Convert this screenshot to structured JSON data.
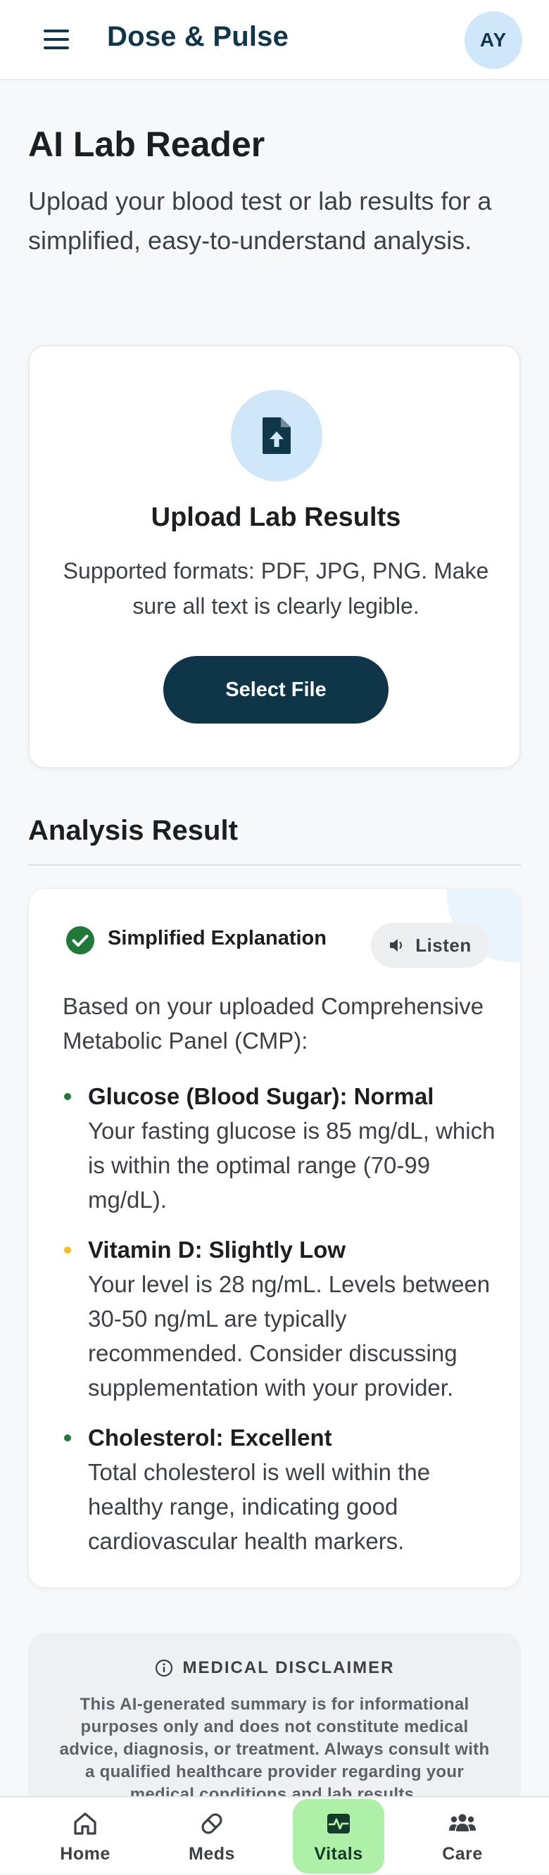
{
  "header": {
    "app_title": "Dose & Pulse",
    "avatar_initials": "AY"
  },
  "page": {
    "title": "AI Lab Reader",
    "subtitle": "Upload your blood test or lab results for a simplified, easy-to-understand analysis."
  },
  "upload": {
    "title": "Upload Lab Results",
    "description": "Supported formats: PDF, JPG, PNG. Make sure all text is clearly legible.",
    "button_label": "Select File"
  },
  "analysis": {
    "heading": "Analysis Result",
    "explain_label": "Simplified Explanation",
    "listen_label": "Listen",
    "intro": "Based on your uploaded Comprehensive Metabolic Panel (CMP):",
    "items": [
      {
        "title": "Glucose (Blood Sugar): Normal",
        "text": "Your fasting glucose is 85 mg/dL, which is within the optimal range (70-99 mg/dL).",
        "status_color": "#1f7a3a"
      },
      {
        "title": "Vitamin D: Slightly Low",
        "text": "Your level is 28 ng/mL. Levels between 30-50 ng/mL are typically recommended. Consider discussing supplementation with your provider.",
        "status_color": "#f2c21b"
      },
      {
        "title": "Cholesterol: Excellent",
        "text": "Total cholesterol is well within the healthy range, indicating good cardiovascular health markers.",
        "status_color": "#1f7a3a"
      }
    ]
  },
  "disclaimer": {
    "title": "MEDICAL DISCLAIMER",
    "text": "This AI-generated summary is for informational purposes only and does not constitute medical advice, diagnosis, or treatment. Always consult with a qualified healthcare provider regarding your medical conditions and lab results."
  },
  "nav": {
    "items": [
      {
        "label": "Home",
        "icon": "home-icon"
      },
      {
        "label": "Meds",
        "icon": "pill-icon"
      },
      {
        "label": "Vitals",
        "icon": "heartbeat-icon"
      },
      {
        "label": "Care",
        "icon": "people-icon"
      }
    ],
    "active": "Vitals"
  },
  "colors": {
    "brand": "#10364a",
    "accent_light": "#cfe7f8",
    "active_nav": "#aef0a8",
    "success": "#1f7a3a",
    "warning": "#f2c21b"
  }
}
